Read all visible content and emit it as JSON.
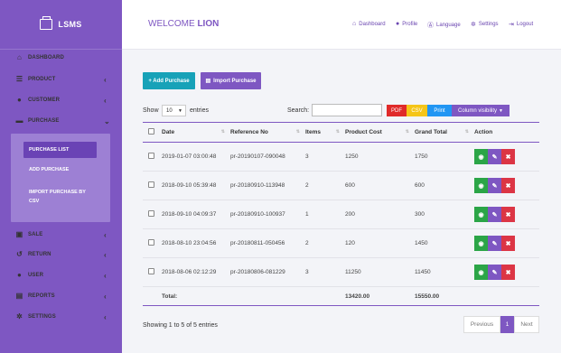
{
  "app": {
    "brand": "LSMS"
  },
  "sidebar": {
    "items": [
      {
        "label": "DASHBOARD",
        "icon": "dashboard-icon",
        "chevron": false
      },
      {
        "label": "PRODUCT",
        "icon": "list-icon",
        "chevron": true
      },
      {
        "label": "CUSTOMER",
        "icon": "user-icon",
        "chevron": true
      },
      {
        "label": "PURCHASE",
        "icon": "card-icon",
        "chevron": true,
        "open": true
      },
      {
        "label": "SALE",
        "icon": "shopping-cart-icon",
        "chevron": true
      },
      {
        "label": "RETURN",
        "icon": "return-icon",
        "chevron": true
      },
      {
        "label": "USER",
        "icon": "user-icon",
        "chevron": true
      },
      {
        "label": "REPORTS",
        "icon": "report-icon",
        "chevron": true
      },
      {
        "label": "SETTINGS",
        "icon": "gear-icon",
        "chevron": true
      }
    ],
    "submenu": [
      {
        "label": "PURCHASE LIST",
        "active": true
      },
      {
        "label": "ADD PURCHASE",
        "active": false
      },
      {
        "label": "IMPORT PURCHASE BY",
        "label2": "CSV",
        "active": false
      }
    ]
  },
  "header": {
    "welcome_prefix": "WELCOME",
    "welcome_name": "LION",
    "nav": [
      {
        "label": "Dashboard",
        "icon": "dashboard-icon"
      },
      {
        "label": "Profile",
        "icon": "user-icon"
      },
      {
        "label": "Language",
        "icon": "language-icon"
      },
      {
        "label": "Settings",
        "icon": "gear-icon"
      },
      {
        "label": "Logout",
        "icon": "logout-icon"
      }
    ]
  },
  "actions": {
    "add_purchase": "+ Add Purchase",
    "import_purchase": "Import Purchase"
  },
  "table_controls": {
    "show_label": "Show",
    "entries_value": "10",
    "entries_label": "entries",
    "search_label": "Search:",
    "search_value": "",
    "export_buttons": [
      "PDF",
      "CSV",
      "Print",
      "Column visibility"
    ]
  },
  "table": {
    "columns": [
      "",
      "Date",
      "Reference No",
      "Items",
      "Product Cost",
      "Grand Total",
      "Action"
    ],
    "rows": [
      {
        "date": "2019-01-07 03:00:48",
        "ref": "pr-20190107-090048",
        "items": "3",
        "cost": "1250",
        "total": "1750"
      },
      {
        "date": "2018-09-10 05:39:48",
        "ref": "pr-20180910-113948",
        "items": "2",
        "cost": "600",
        "total": "600"
      },
      {
        "date": "2018-09-10 04:09:37",
        "ref": "pr-20180910-100937",
        "items": "1",
        "cost": "200",
        "total": "300"
      },
      {
        "date": "2018-08-10 23:04:56",
        "ref": "pr-20180811-050456",
        "items": "2",
        "cost": "120",
        "total": "1450"
      },
      {
        "date": "2018-08-06 02:12:29",
        "ref": "pr-20180806-081229",
        "items": "3",
        "cost": "11250",
        "total": "11450"
      }
    ],
    "footer": {
      "label": "Total:",
      "cost": "13420.00",
      "total": "15550.00"
    }
  },
  "pagination": {
    "info": "Showing 1 to 5 of 5 entries",
    "previous": "Previous",
    "current": "1",
    "next": "Next"
  },
  "colors": {
    "primary": "#7e57c2",
    "teal": "#17a2b8",
    "green": "#2ba547",
    "red": "#dc3545",
    "pdf": "#e02a2a",
    "csv": "#f5c518",
    "print": "#2196f3"
  }
}
